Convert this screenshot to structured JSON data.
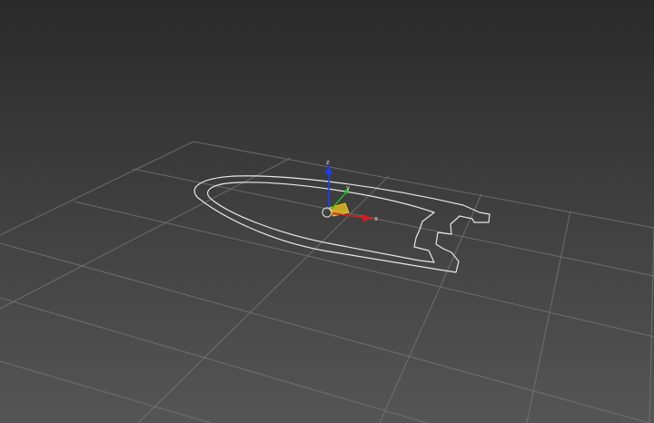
{
  "viewport": {
    "background_top": "#2a2a2a",
    "background_bottom": "#555555",
    "grid_color": "#7a7a7a",
    "shape_stroke": "#e8e8e8"
  },
  "gizmo": {
    "axis_x_label": "x",
    "axis_y_label": "y",
    "axis_z_label": "z",
    "axis_x_color": "#e01818",
    "axis_y_color": "#1fc21f",
    "axis_z_color": "#1c3cff",
    "plane_color": "#ffd21a",
    "pivot_color": "#cfcfcf"
  }
}
